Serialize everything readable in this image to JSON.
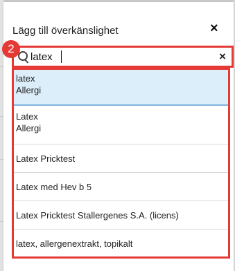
{
  "dialog": {
    "title": "Lägg till överkänslighet",
    "close_symbol": "×"
  },
  "search": {
    "value": "latex",
    "clear_symbol": "×",
    "search_icon": "magnifier-icon"
  },
  "annotation": {
    "badge_number": "2",
    "highlight_color": "#e53935"
  },
  "results": [
    {
      "name": "latex",
      "type": "Allergi"
    },
    {
      "name": "Latex",
      "type": "Allergi"
    },
    {
      "name": "Latex Pricktest"
    },
    {
      "name": "Latex med Hev b 5"
    },
    {
      "name": "Latex Pricktest Stallergenes S.A. (licens)"
    },
    {
      "name": "latex, allergenextrakt, topikalt"
    }
  ],
  "colors": {
    "selected_row": "#dceef9",
    "selected_row_underline": "#7fb4dd"
  }
}
